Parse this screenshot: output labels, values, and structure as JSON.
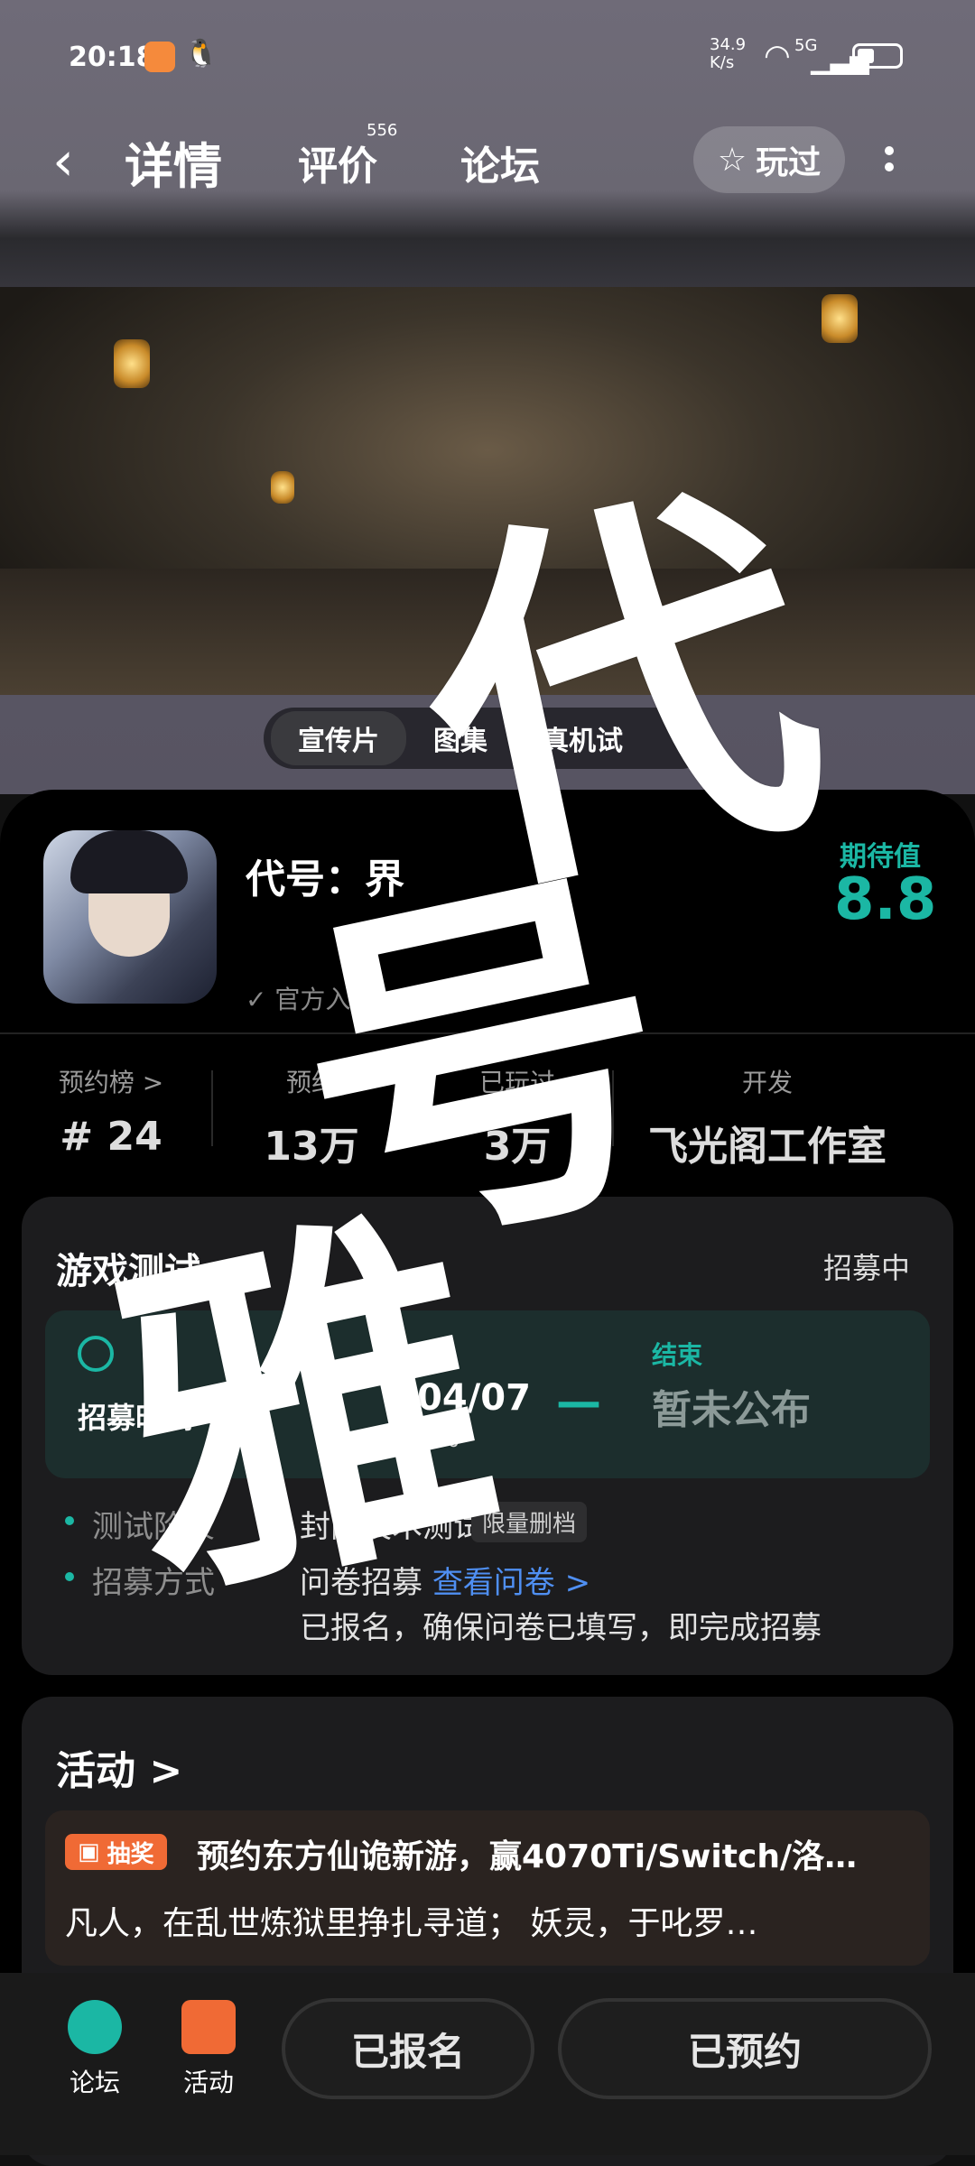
{
  "status_bar": {
    "time": "20:18",
    "net_speed": "34.9\nK/s",
    "signal_label": "5G"
  },
  "nav": {
    "tabs": [
      {
        "label": "详情"
      },
      {
        "label": "评价",
        "badge": "556"
      },
      {
        "label": "论坛"
      }
    ],
    "played_label": "玩过"
  },
  "media": {
    "tabs": [
      "宣传片",
      "图集",
      "真机试"
    ]
  },
  "game": {
    "title": "代号：界",
    "official": "官方入驻",
    "expect_label": "期待值",
    "expect_value": "8.8"
  },
  "stats": [
    {
      "label": "预约榜 >",
      "value": "# 24"
    },
    {
      "label": "预约",
      "value": "13万"
    },
    {
      "label": "已玩过",
      "value": "3万"
    },
    {
      "label": "开发",
      "value": "飞光阁工作室"
    }
  ],
  "test": {
    "title": "游戏测试",
    "status": "招募中",
    "start_label": "招募时间",
    "start_date": "04/07",
    "start_time": "00:00",
    "end_label": "结束",
    "end_value": "暂未公布",
    "stage_label": "测试阶段",
    "stage_value": "封闭技术测试",
    "stage_tag": "限量删档",
    "method_label": "招募方式",
    "method_value": "问卷招募",
    "method_link": "查看问卷 >",
    "method_note": "已报名，确保问卷已填写，即完成招募"
  },
  "activity": {
    "title": "活动 >",
    "badge": "抽奖",
    "line1": "预约东方仙诡新游，赢4070Ti/Switch/洛…",
    "line2": "凡人，在乱世炼狱里挣扎寻道； 妖灵，于叱罗…"
  },
  "bottom": {
    "forum": "论坛",
    "activity": "活动",
    "signed_up": "已报名",
    "reserved": "已预约"
  },
  "watermark": {
    "c1": "代",
    "c2": "号",
    "c3": "雅"
  },
  "colors": {
    "accent": "#1bb7a4",
    "link": "#4f8ff2",
    "lottery": "#f06a35"
  }
}
